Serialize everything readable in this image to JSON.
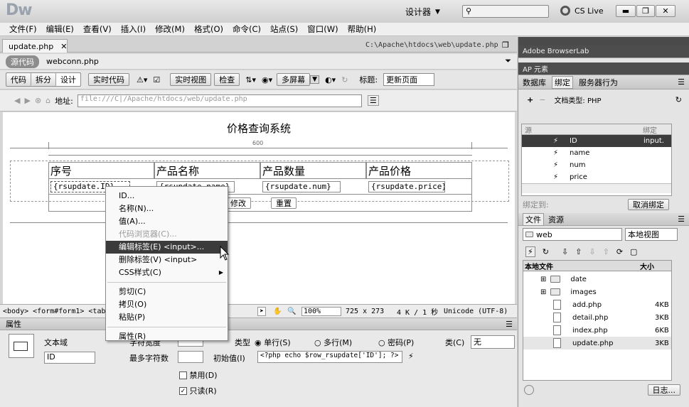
{
  "app": {
    "logo": "Dw",
    "workspace": "设计器",
    "product": "CS Live"
  },
  "menu": [
    "文件(F)",
    "编辑(E)",
    "查看(V)",
    "插入(I)",
    "修改(M)",
    "格式(O)",
    "命令(C)",
    "站点(S)",
    "窗口(W)",
    "帮助(H)"
  ],
  "doc": {
    "tab": "update.php",
    "path": "C:\\Apache\\htdocs\\web\\update.php",
    "source_badge": "源代码",
    "related_file": "webconn.php"
  },
  "toolbar": {
    "code": "代码",
    "split": "拆分",
    "design": "设计",
    "live_code": "实时代码",
    "live_view": "实时视图",
    "inspect": "检查",
    "multiscreen": "多屏幕",
    "title_label": "标题:",
    "title_value": "更新页面"
  },
  "address": {
    "label": "地址:",
    "value": "file:///C|/Apache/htdocs/web/update.php"
  },
  "page": {
    "heading": "价格查询系统",
    "width_label": "600",
    "col1": "序号",
    "col2": "产品名称",
    "col3": "产品数量",
    "col4": "产品价格",
    "f1": "{rsupdate.ID}",
    "f2": "{rsupdate.name}",
    "f3": "{rsupdate.num}",
    "f4": "{rsupdate.price}",
    "btn_modify": "修改",
    "btn_reset": "重置"
  },
  "context_menu": {
    "id": "ID...",
    "name": "名称(N)...",
    "value": "值(A)...",
    "code_browser": "代码浏览器(C)...",
    "edit_tag": "编辑标签(E) <input>...",
    "delete_tag": "删除标签(V) <input>",
    "css": "CSS样式(C)",
    "cut": "剪切(C)",
    "copy": "拷贝(O)",
    "paste": "粘贴(P)",
    "attributes": "属性(R)"
  },
  "statusbar": {
    "tags": "<body> <form#form1> <tabl",
    "zoom": "100%",
    "size": "725 x 273",
    "weight": "4 K / 1 秒",
    "encoding": "Unicode (UTF-8)"
  },
  "properties": {
    "header": "属性",
    "type_label": "文本域",
    "id_value": "ID",
    "char_width": "字符宽度",
    "max_chars": "最多字符数",
    "type": "类型",
    "single": "单行(S)",
    "multi": "多行(M)",
    "password": "密码(P)",
    "init_val": "初始值(I)",
    "init_value": "<?php echo $row_rsupdate['ID']; ?>",
    "class_label": "类(C)",
    "class_value": "无",
    "disabled": "禁用(D)",
    "readonly": "只读(R)"
  },
  "panels": {
    "browserlab": "Adobe BrowserLab",
    "ap": "AP 元素",
    "db_tab": "数据库",
    "bind_tab": "绑定",
    "server_tab": "服务器行为",
    "doc_type": "文档类型: PHP",
    "col_source": "源",
    "col_binding": "绑定",
    "bindings": [
      {
        "name": "ID",
        "value": "input."
      },
      {
        "name": "name",
        "value": ""
      },
      {
        "name": "num",
        "value": ""
      },
      {
        "name": "price",
        "value": ""
      }
    ],
    "bind_to": "绑定到:",
    "unbind": "取消绑定",
    "files_tab": "文件",
    "assets_tab": "资源",
    "site": "web",
    "view": "本地视图",
    "local_files": "本地文件",
    "size": "大小",
    "files": [
      {
        "name": "date",
        "size": "",
        "type": "folder"
      },
      {
        "name": "images",
        "size": "",
        "type": "folder"
      },
      {
        "name": "add.php",
        "size": "4KB",
        "type": "file"
      },
      {
        "name": "detail.php",
        "size": "3KB",
        "type": "file"
      },
      {
        "name": "index.php",
        "size": "6KB",
        "type": "file"
      },
      {
        "name": "update.php",
        "size": "3KB",
        "type": "file"
      }
    ],
    "log": "日志..."
  }
}
